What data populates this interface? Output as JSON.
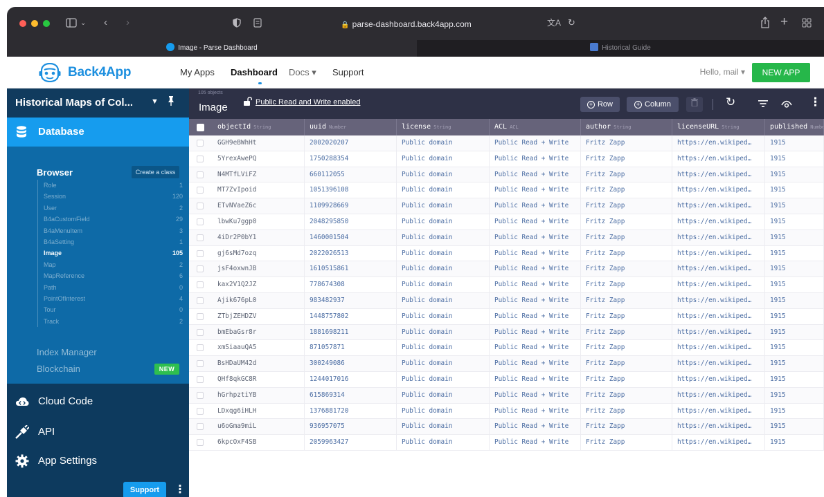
{
  "browser": {
    "url": "parse-dashboard.back4app.com",
    "tabs": [
      {
        "title": "Image - Parse Dashboard",
        "active": true
      },
      {
        "title": "Historical Guide",
        "active": false
      }
    ]
  },
  "header": {
    "brand": "Back4App",
    "nav": [
      "My Apps",
      "Dashboard",
      "Docs ▾",
      "Support"
    ],
    "greeting": "Hello, mail ▾",
    "new_app": "NEW APP"
  },
  "sidebar": {
    "app_name": "Historical Maps of Col...",
    "database": "Database",
    "browser": "Browser",
    "create_class": "Create a class",
    "classes": [
      {
        "name": "Role",
        "count": "1"
      },
      {
        "name": "Session",
        "count": "120"
      },
      {
        "name": "User",
        "count": "2"
      },
      {
        "name": "B4aCustomField",
        "count": "29"
      },
      {
        "name": "B4aMenuItem",
        "count": "3"
      },
      {
        "name": "B4aSetting",
        "count": "1"
      },
      {
        "name": "Image",
        "count": "105",
        "active": true
      },
      {
        "name": "Map",
        "count": "2"
      },
      {
        "name": "MapReference",
        "count": "6"
      },
      {
        "name": "Path",
        "count": "0"
      },
      {
        "name": "PointOfInterest",
        "count": "4"
      },
      {
        "name": "Tour",
        "count": "0"
      },
      {
        "name": "Track",
        "count": "2"
      }
    ],
    "index_manager": "Index Manager",
    "blockchain": "Blockchain",
    "new_badge": "NEW",
    "cloud_code": "Cloud Code",
    "api": "API",
    "app_settings": "App Settings",
    "support": "Support"
  },
  "toolbar": {
    "object_count": "105 objects",
    "class_name": "Image",
    "acl_text": "Public Read and Write enabled",
    "row_btn": "Row",
    "column_btn": "Column"
  },
  "table": {
    "columns": [
      {
        "name": "objectId",
        "type": "String"
      },
      {
        "name": "uuid",
        "type": "Number"
      },
      {
        "name": "license",
        "type": "String"
      },
      {
        "name": "ACL",
        "type": "ACL"
      },
      {
        "name": "author",
        "type": "String"
      },
      {
        "name": "licenseURL",
        "type": "String"
      },
      {
        "name": "published",
        "type": "Number"
      }
    ],
    "rows": [
      [
        "GGH9eBWhHt",
        "2002020207",
        "Public domain",
        "Public Read + Write",
        "Fritz Zapp",
        "https://en.wikiped…",
        "1915"
      ],
      [
        "5YrexAwePQ",
        "1750288354",
        "Public domain",
        "Public Read + Write",
        "Fritz Zapp",
        "https://en.wikiped…",
        "1915"
      ],
      [
        "N4MTfLViFZ",
        "660112055",
        "Public domain",
        "Public Read + Write",
        "Fritz Zapp",
        "https://en.wikiped…",
        "1915"
      ],
      [
        "MT7ZvIpoid",
        "1051396108",
        "Public domain",
        "Public Read + Write",
        "Fritz Zapp",
        "https://en.wikiped…",
        "1915"
      ],
      [
        "ETvNVaeZ6c",
        "1109928669",
        "Public domain",
        "Public Read + Write",
        "Fritz Zapp",
        "https://en.wikiped…",
        "1915"
      ],
      [
        "lbwKu7ggp0",
        "2048295850",
        "Public domain",
        "Public Read + Write",
        "Fritz Zapp",
        "https://en.wikiped…",
        "1915"
      ],
      [
        "4iDr2P0bY1",
        "1460001504",
        "Public domain",
        "Public Read + Write",
        "Fritz Zapp",
        "https://en.wikiped…",
        "1915"
      ],
      [
        "gj6sMd7ozq",
        "2022026513",
        "Public domain",
        "Public Read + Write",
        "Fritz Zapp",
        "https://en.wikiped…",
        "1915"
      ],
      [
        "jsF4oxwnJB",
        "1610515861",
        "Public domain",
        "Public Read + Write",
        "Fritz Zapp",
        "https://en.wikiped…",
        "1915"
      ],
      [
        "kax2V1Q2JZ",
        "778674308",
        "Public domain",
        "Public Read + Write",
        "Fritz Zapp",
        "https://en.wikiped…",
        "1915"
      ],
      [
        "Ajik676pL0",
        "983482937",
        "Public domain",
        "Public Read + Write",
        "Fritz Zapp",
        "https://en.wikiped…",
        "1915"
      ],
      [
        "ZTbjZEHDZV",
        "1448757802",
        "Public domain",
        "Public Read + Write",
        "Fritz Zapp",
        "https://en.wikiped…",
        "1915"
      ],
      [
        "bmEbaGsr8r",
        "1881698211",
        "Public domain",
        "Public Read + Write",
        "Fritz Zapp",
        "https://en.wikiped…",
        "1915"
      ],
      [
        "xmSiaauQA5",
        "871057871",
        "Public domain",
        "Public Read + Write",
        "Fritz Zapp",
        "https://en.wikiped…",
        "1915"
      ],
      [
        "BsHDaUM42d",
        "300249086",
        "Public domain",
        "Public Read + Write",
        "Fritz Zapp",
        "https://en.wikiped…",
        "1915"
      ],
      [
        "QHf8qkGC8R",
        "1244017016",
        "Public domain",
        "Public Read + Write",
        "Fritz Zapp",
        "https://en.wikiped…",
        "1915"
      ],
      [
        "hGrhpztiYB",
        "615869314",
        "Public domain",
        "Public Read + Write",
        "Fritz Zapp",
        "https://en.wikiped…",
        "1915"
      ],
      [
        "LDxqg6iHLH",
        "1376881720",
        "Public domain",
        "Public Read + Write",
        "Fritz Zapp",
        "https://en.wikiped…",
        "1915"
      ],
      [
        "u6oGma9miL",
        "936957075",
        "Public domain",
        "Public Read + Write",
        "Fritz Zapp",
        "https://en.wikiped…",
        "1915"
      ],
      [
        "6kpcOxF4SB",
        "2059963427",
        "Public domain",
        "Public Read + Write",
        "Fritz Zapp",
        "https://en.wikiped…",
        "1915"
      ]
    ]
  },
  "colors": {
    "brand_blue": "#169cee",
    "sidebar_bg": "#0e6aa7",
    "sidebar_dark": "#0d3a5e",
    "toolbar_bg": "#2e3146",
    "table_header": "#66637a",
    "new_app_green": "#26b74a"
  },
  "icons": {
    "sidebar_toggle": "sidebar-icon",
    "back": "chevron-left-icon",
    "forward": "chevron-right-icon",
    "shield": "shield-icon",
    "reader": "reader-icon",
    "translate": "translate-icon",
    "reload": "reload-icon",
    "share": "share-icon",
    "new_tab": "plus-icon",
    "tab_overview": "grid-icon",
    "pin": "pin-icon",
    "database": "database-icon",
    "cloud": "cloud-code-icon",
    "api": "plug-icon",
    "settings": "gear-icon",
    "refresh": "refresh-icon",
    "filter": "filter-icon",
    "eye": "eye-icon",
    "more": "more-vertical-icon",
    "trash": "trash-icon"
  }
}
